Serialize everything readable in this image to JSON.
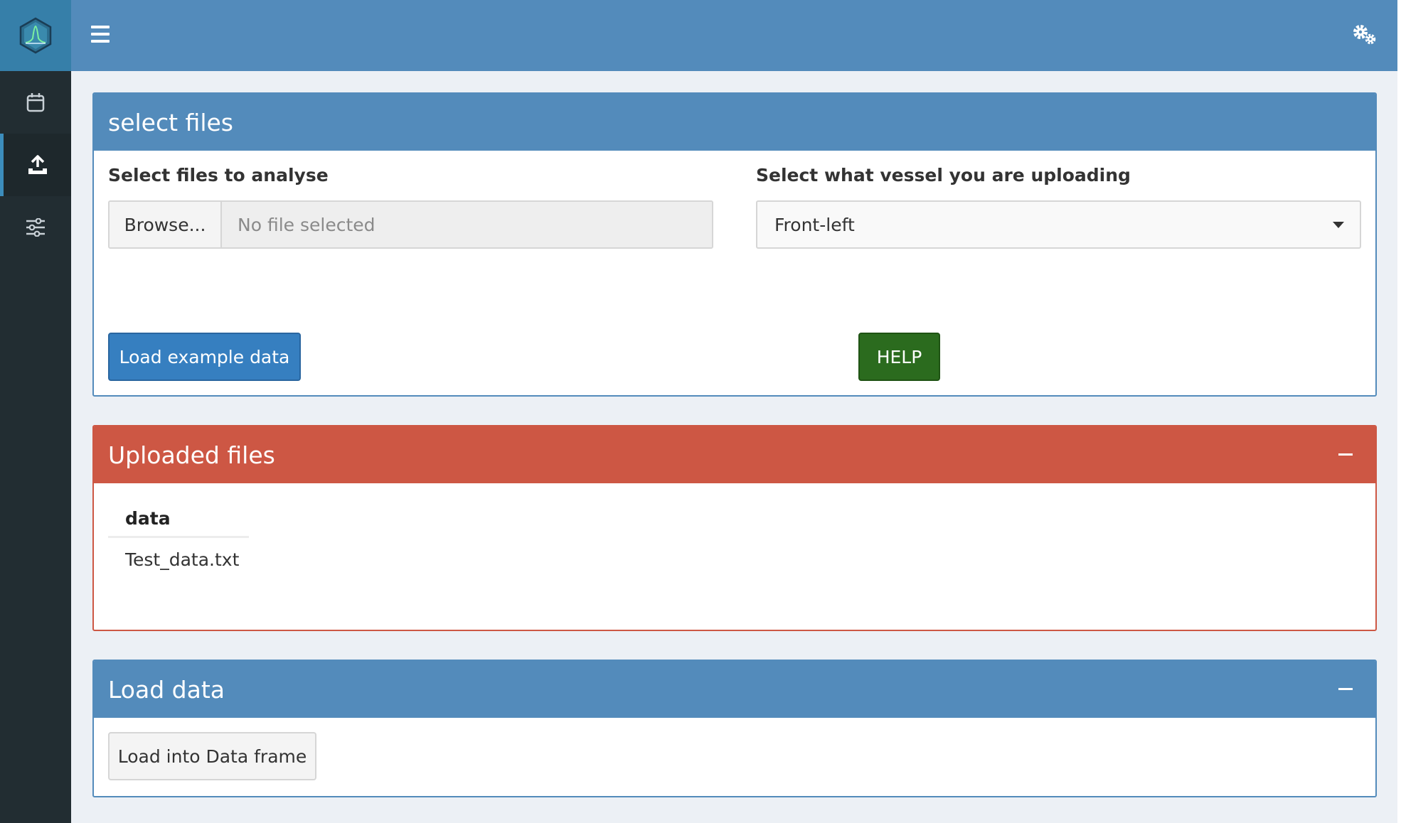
{
  "app": {
    "logo_icon": "hexagon-chromatogram-logo",
    "colors": {
      "header": "#538bbb",
      "sidebar": "#222d32",
      "content_bg": "#ecf0f5",
      "danger": "#cd5744",
      "primary_button": "#367fc0",
      "success_button": "#2b6b1e"
    }
  },
  "sidebar": {
    "items": [
      {
        "icon": "calendar-icon",
        "active": false
      },
      {
        "icon": "upload-icon",
        "active": true
      },
      {
        "icon": "sliders-icon",
        "active": false
      }
    ]
  },
  "header": {
    "menu_icon": "hamburger-icon",
    "settings_icon": "gears-icon"
  },
  "select_files": {
    "title": "select files",
    "files_label": "Select files to analyse",
    "browse_label": "Browse...",
    "file_placeholder": "No file selected",
    "vessel_label": "Select what vessel you are uploading",
    "vessel_selected": "Front-left",
    "load_example_label": "Load example data",
    "help_label": "HELP"
  },
  "uploaded_files": {
    "title": "Uploaded files",
    "column_header": "data",
    "rows": [
      "Test_data.txt"
    ]
  },
  "load_data": {
    "title": "Load data",
    "button_label": "Load into Data frame"
  }
}
